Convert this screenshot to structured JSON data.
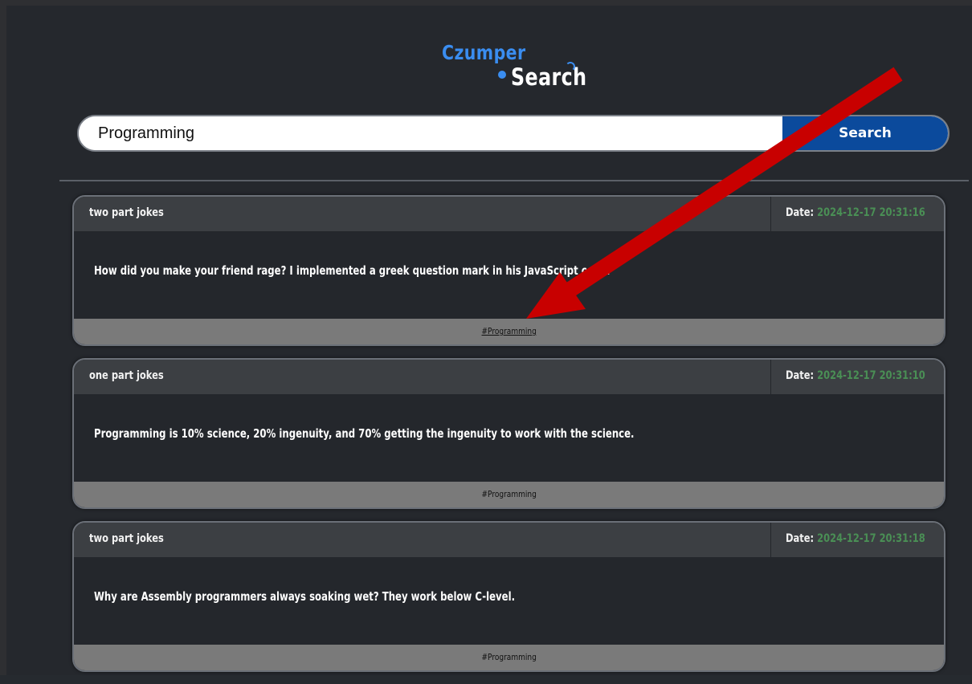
{
  "logo": {
    "line1": "Czumper",
    "line2": "Search"
  },
  "search": {
    "value": "Programming",
    "button_label": "Search"
  },
  "results": [
    {
      "category": "two part jokes",
      "date_label": "Date:",
      "date": "2024-12-17 20:31:16",
      "text": "How did you make your friend rage? I implemented a greek question mark in his JavaScript code.",
      "tag": "#Programming"
    },
    {
      "category": "one part jokes",
      "date_label": "Date:",
      "date": "2024-12-17 20:31:10",
      "text": "Programming is 10% science, 20% ingenuity, and 70% getting the ingenuity to work with the science.",
      "tag": "#Programming"
    },
    {
      "category": "two part jokes",
      "date_label": "Date:",
      "date": "2024-12-17 20:31:18",
      "text": "Why are Assembly programmers always soaking wet? They work below C-level.",
      "tag": "#Programming"
    }
  ],
  "colors": {
    "accent_blue": "#3a8df0",
    "button_blue": "#0b4a9c",
    "date_green": "#4a8f55",
    "arrow_red": "#c80000"
  }
}
